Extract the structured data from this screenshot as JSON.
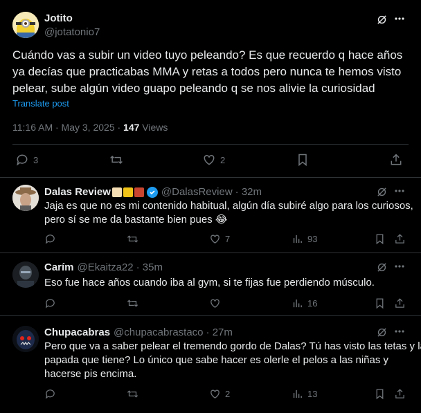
{
  "main": {
    "name": "Jotito",
    "handle": "@jotatonio7",
    "text": "Cuándo vas a subir un video tuyo peleando? Es que recuerdo q hace años ya decías que practicabas MMA y retas a todos pero nunca te hemos visto pelear, sube algún video guapo peleando q se nos alivie la curiosidad",
    "translate": "Translate post",
    "time": "11:16 AM · May 3, 2025 · ",
    "views_count": "147",
    "views_label": " Views",
    "reply_count": "3",
    "like_count": "2"
  },
  "replies": [
    {
      "name": "Dalas Review",
      "handle": "@DalasReview",
      "age": "· 32m",
      "text_line1": "Jaja es que no es mi contenido habitual, algún día subiré algo para los curiosos,",
      "text_line2": "pero sí se me da bastante bien pues 😂",
      "likes": "7",
      "views": "93"
    },
    {
      "name": "Carím",
      "handle": "@Ekaitza22",
      "age": "· 35m",
      "text_line1": "Eso fue hace años cuando iba al gym, si te fijas fue perdiendo músculo.",
      "likes": "",
      "views": "16"
    },
    {
      "name": "Chupacabras",
      "handle": "@chupacabrastaco",
      "age": "· 27m",
      "text_line1": "Pero que va a saber pelear el tremendo gordo de Dalas? Tú has visto las tetas y la",
      "text_line2": "papada que tiene? Lo único que sabe hacer es olerle el pelos a las niñas y",
      "text_line3": "hacerse pis encima.",
      "likes": "2",
      "views": "13"
    }
  ],
  "colors": {
    "background": "#000000",
    "text": "#e7e9ea",
    "muted": "#71767b",
    "link": "#1d9bf0",
    "border": "#2f3336"
  },
  "icons": [
    "grok-icon",
    "more-icon",
    "reply-icon",
    "retweet-icon",
    "like-icon",
    "bookmark-icon",
    "share-icon",
    "views-icon",
    "verified-icon"
  ]
}
